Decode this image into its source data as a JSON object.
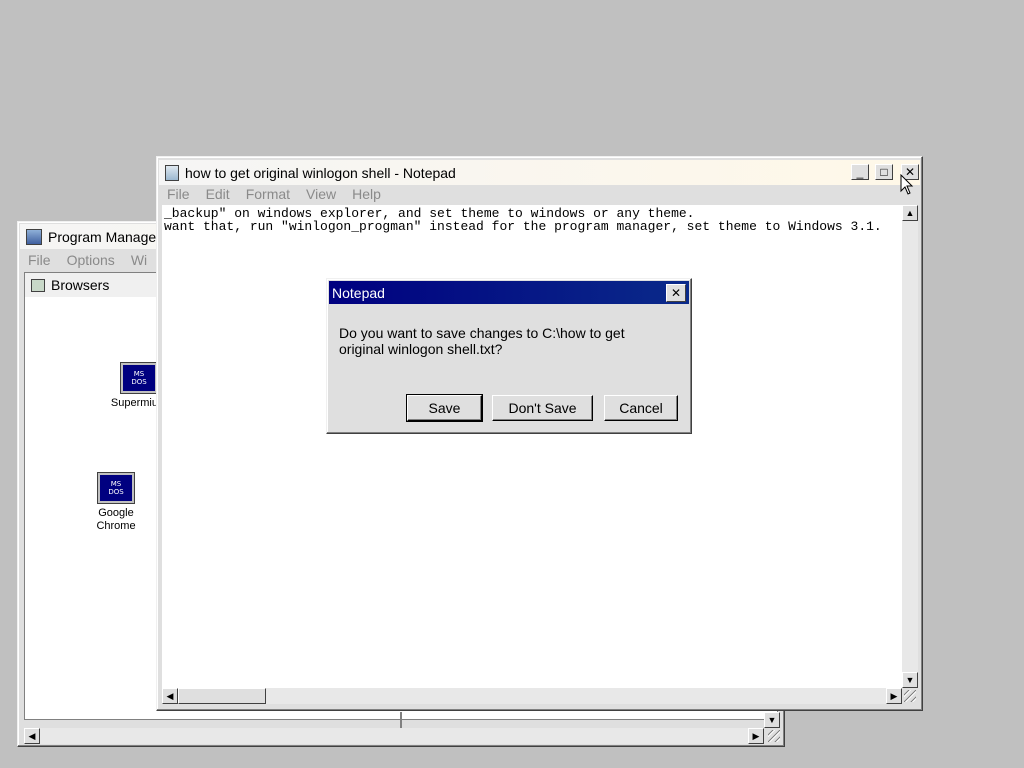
{
  "program_manager": {
    "title": "Program Manage",
    "menu": [
      "File",
      "Options",
      "Wi"
    ],
    "group": {
      "title": "Browsers",
      "icons": [
        {
          "label": "Supermium",
          "badge_top": "MS",
          "badge_bottom": "DOS"
        },
        {
          "label": "Google Chrome",
          "badge_top": "MS",
          "badge_bottom": "DOS"
        }
      ]
    }
  },
  "notepad": {
    "title": "how to get original winlogon shell - Notepad",
    "menu": [
      "File",
      "Edit",
      "Format",
      "View",
      "Help"
    ],
    "lines": [
      "_backup\" on windows explorer, and set theme to windows or any theme.",
      "want that, run \"winlogon_progman\" instead for the program manager, set theme to Windows 3.1."
    ],
    "controls": {
      "minimize": "_",
      "maximize": "□",
      "close": "✕"
    }
  },
  "dialog": {
    "title": "Notepad",
    "message_line1": "Do you want to save changes to C:\\how to get",
    "message_line2": "original winlogon shell.txt?",
    "buttons": {
      "save": "Save",
      "dont_save": "Don't Save",
      "cancel": "Cancel"
    },
    "close": "✕"
  },
  "colors": {
    "desktop": "#c0c0c0",
    "active_title": "#000080",
    "disabled_text": "#8a8a8a"
  }
}
